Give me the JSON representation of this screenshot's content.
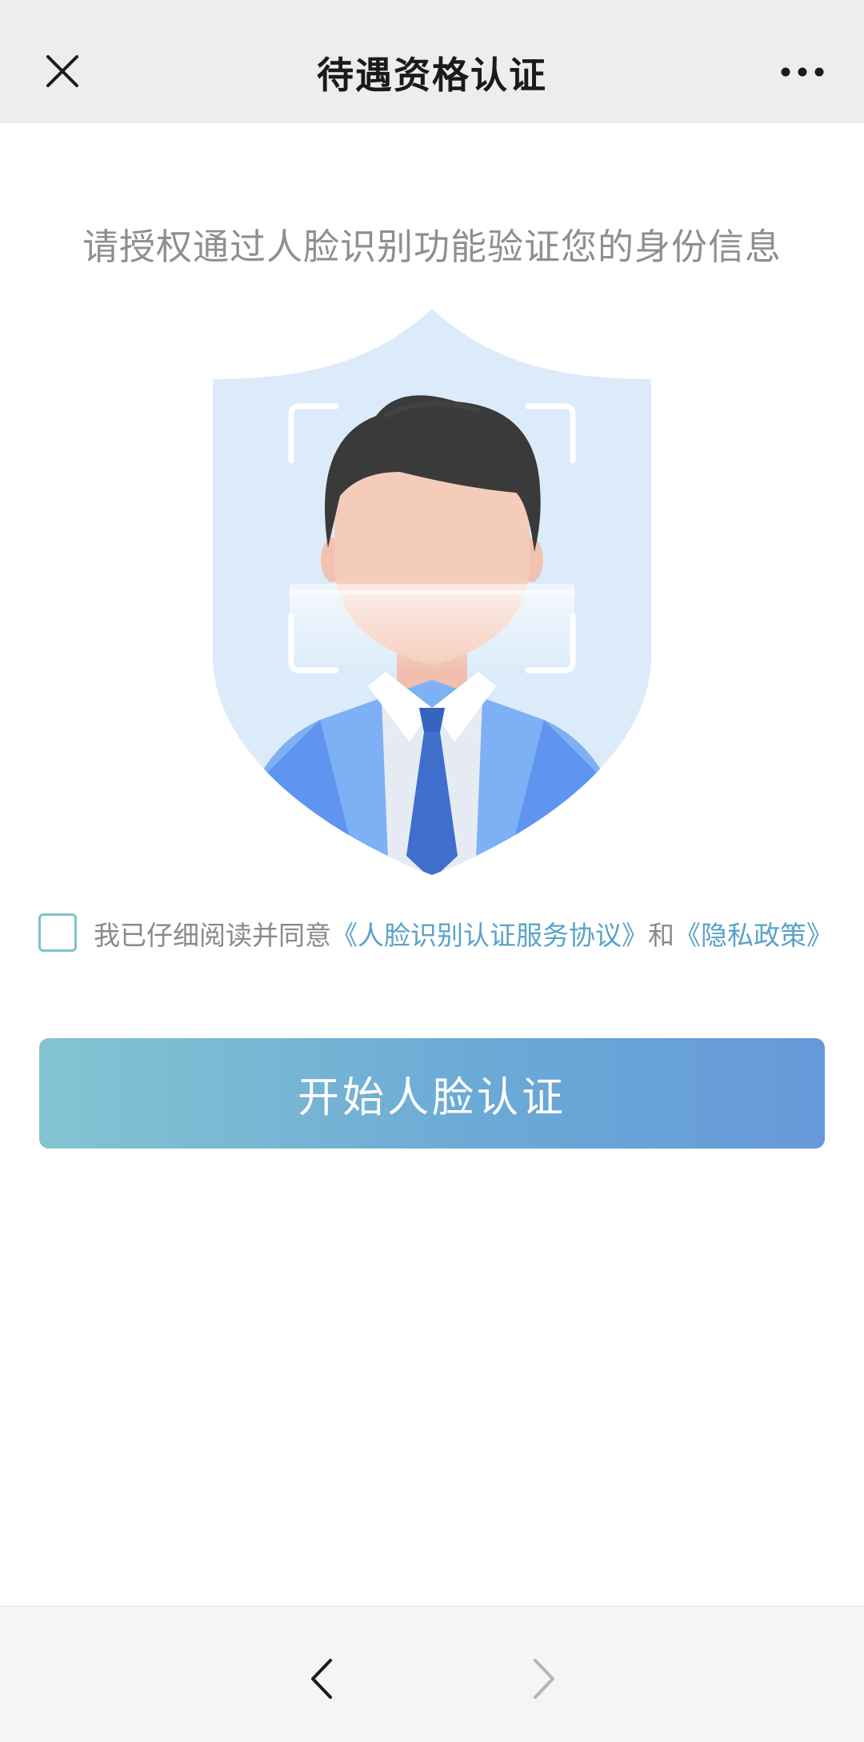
{
  "header": {
    "title": "待遇资格认证",
    "close_icon": "close-icon",
    "more_icon": "more-horizontal-icon"
  },
  "main": {
    "subtitle": "请授权通过人脸识别功能验证您的身份信息",
    "illustration_icon": "face-recognition-shield-illustration",
    "agreement": {
      "checked": false,
      "prefix": "我已仔细阅读并同意",
      "link1": "《人脸识别认证服务协议》",
      "connector": "和",
      "link2": "《隐私政策》"
    },
    "start_button_label": "开始人脸认证"
  },
  "bottom_nav": {
    "back_icon": "chevron-left-icon",
    "forward_icon": "chevron-right-icon"
  },
  "colors": {
    "accent": "#5aa3c8",
    "button_start": "#84c4d1",
    "button_end": "#6699da",
    "shield": "#dcebfa"
  }
}
